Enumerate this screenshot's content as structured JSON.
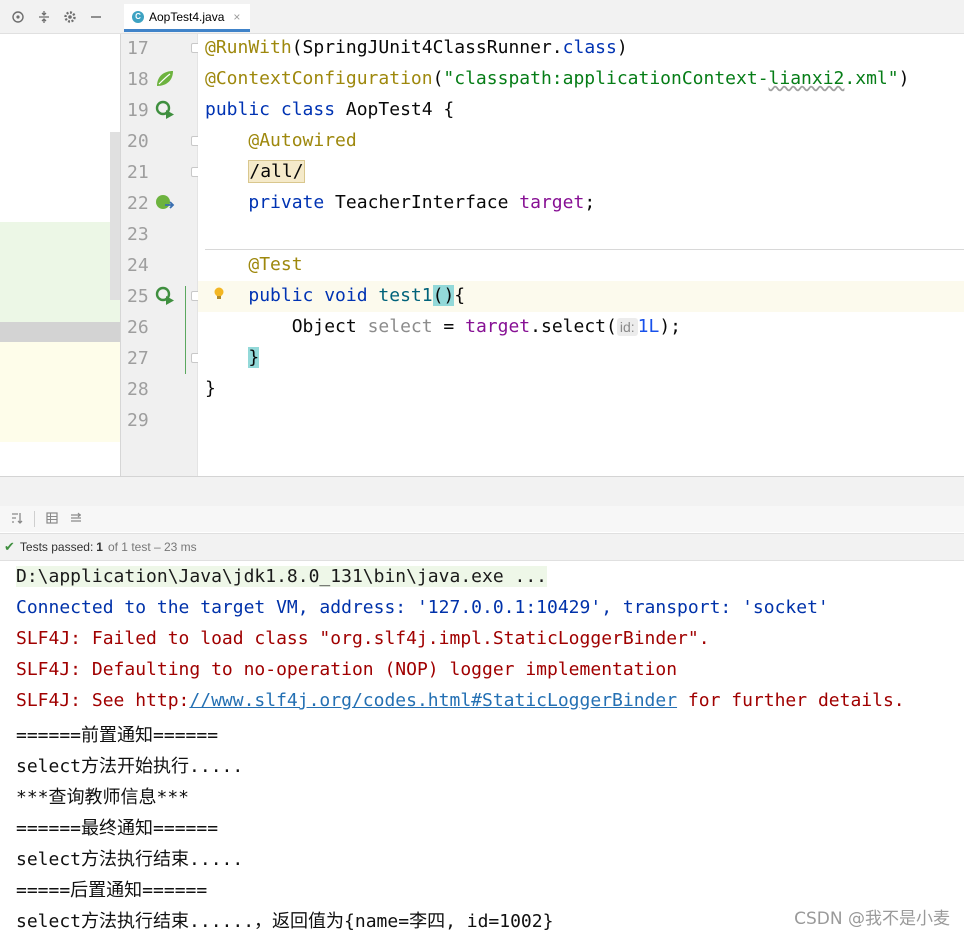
{
  "tab": {
    "label": "AopTest4.java",
    "icon": "java-class-icon",
    "close": "×"
  },
  "toolbar": {
    "icons": [
      "crosshair-icon",
      "collapse-icon",
      "gear-icon",
      "minimize-icon"
    ]
  },
  "lines": [
    {
      "n": "17"
    },
    {
      "n": "18"
    },
    {
      "n": "19"
    },
    {
      "n": "20"
    },
    {
      "n": "21"
    },
    {
      "n": "22"
    },
    {
      "n": "23"
    },
    {
      "n": "24"
    },
    {
      "n": "25"
    },
    {
      "n": "26"
    },
    {
      "n": "27"
    },
    {
      "n": "28"
    },
    {
      "n": "29"
    }
  ],
  "code": {
    "l17": {
      "ann": "@RunWith",
      "p1": "(SpringJUnit4ClassRunner.",
      "kw": "class",
      "p2": ")"
    },
    "l18": {
      "ann": "@ContextConfiguration",
      "p1": "(",
      "str1": "\"classpath:applicationContext-",
      "str2": "lianxi2",
      "str3": ".xml\"",
      "p2": ")"
    },
    "l19": {
      "kw": "public class",
      "rest": " AopTest4 {"
    },
    "l20": {
      "ann": "@Autowired"
    },
    "l21": {
      "tag": "/all/"
    },
    "l22": {
      "kw": "private",
      "type": " TeacherInterface ",
      "fld": "target",
      "end": ";"
    },
    "l24": {
      "ann": "@Test"
    },
    "l25": {
      "kw": "public void",
      "fn": " test1",
      "br1": "()",
      "br2": "{"
    },
    "l26": {
      "type": "Object ",
      "var": "select",
      "eq": " = ",
      "fld": "target",
      "call": ".select(",
      "hint": "id:",
      "num": "1L",
      "end": ");"
    },
    "l27": {
      "br": "}"
    },
    "l28": {
      "br": "}"
    }
  },
  "status": {
    "label": "Tests passed:",
    "count": "1",
    "rest": "of 1 test – 23 ms"
  },
  "console": {
    "cmd": "D:\\application\\Java\\jdk1.8.0_131\\bin\\java.exe ...",
    "connected": "Connected to the target VM, address: '127.0.0.1:10429', transport: 'socket'",
    "slf1": "SLF4J: Failed to load class \"org.slf4j.impl.StaticLoggerBinder\".",
    "slf2": "SLF4J: Defaulting to no-operation (NOP) logger implementation",
    "slf3_pre": "SLF4J: See http:",
    "slf3_link": "//www.slf4j.org/codes.html#StaticLoggerBinder",
    "slf3_post": " for further details.",
    "out": [
      "======前置通知======",
      "select方法开始执行.....",
      "***查询教师信息***",
      "======最终通知======",
      "select方法执行结束.....",
      "=====后置通知======",
      "select方法执行结束......，返回值为{name=李四, id=1002}"
    ]
  },
  "watermark": "CSDN @我不是小麦",
  "colors": {
    "accent": "#4083c9",
    "annotation": "#9e880d",
    "keyword": "#0033b3",
    "string": "#067d17",
    "field": "#871094",
    "error": "#a00000",
    "vm": "#0032aa"
  }
}
